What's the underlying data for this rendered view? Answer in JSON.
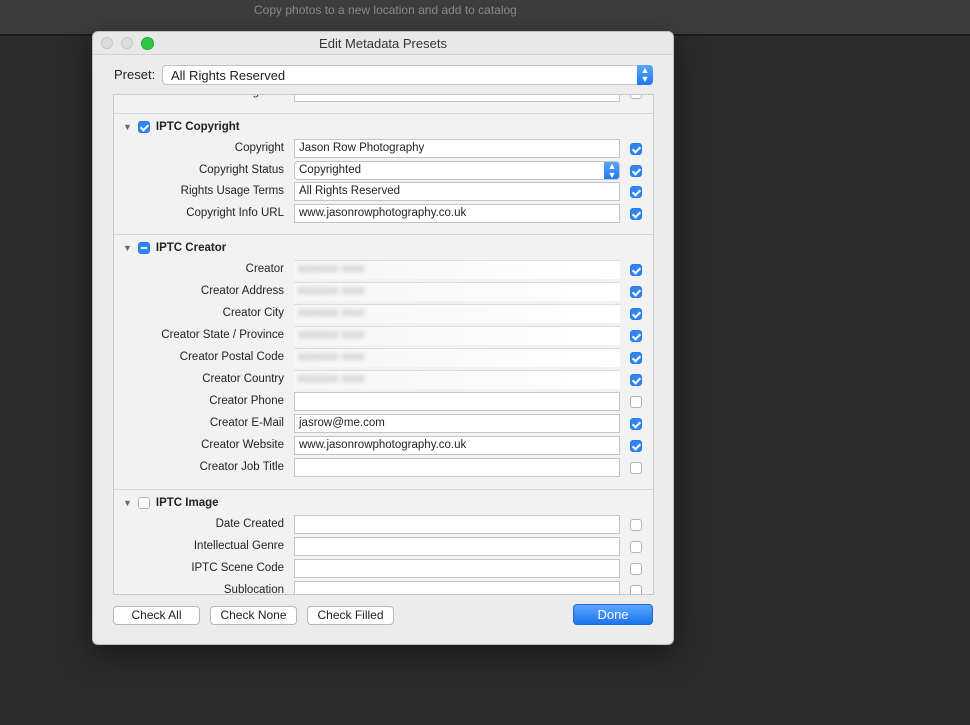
{
  "background_app": {
    "subtitle": "Copy photos to a new location and add to catalog"
  },
  "dialog": {
    "title": "Edit Metadata Presets",
    "preset_label": "Preset:",
    "preset_value": "All Rights Reserved",
    "partial_row": {
      "label": "Other Categories",
      "value": "",
      "checked": false
    },
    "sections": [
      {
        "title": "IPTC Copyright",
        "state": "checked",
        "fields": [
          {
            "label": "Copyright",
            "value": "Jason Row Photography",
            "checked": true,
            "type": "text"
          },
          {
            "label": "Copyright Status",
            "value": "Copyrighted",
            "checked": true,
            "type": "select"
          },
          {
            "label": "Rights Usage Terms",
            "value": "All Rights Reserved",
            "checked": true,
            "type": "text"
          },
          {
            "label": "Copyright Info URL",
            "value": "www.jasonrowphotography.co.uk",
            "checked": true,
            "type": "text"
          }
        ]
      },
      {
        "title": "IPTC Creator",
        "state": "mixed",
        "fields": [
          {
            "label": "Creator",
            "value": "[blurred]",
            "checked": true,
            "type": "blurred"
          },
          {
            "label": "Creator Address",
            "value": "[blurred]",
            "checked": true,
            "type": "blurred"
          },
          {
            "label": "Creator City",
            "value": "[blurred]",
            "checked": true,
            "type": "blurred"
          },
          {
            "label": "Creator State / Province",
            "value": "[blurred]",
            "checked": true,
            "type": "blurred"
          },
          {
            "label": "Creator Postal Code",
            "value": "[blurred]",
            "checked": true,
            "type": "blurred"
          },
          {
            "label": "Creator Country",
            "value": "[blurred]",
            "checked": true,
            "type": "blurred"
          },
          {
            "label": "Creator Phone",
            "value": "",
            "checked": false,
            "type": "text"
          },
          {
            "label": "Creator E-Mail",
            "value": "jasrow@me.com",
            "checked": true,
            "type": "text"
          },
          {
            "label": "Creator Website",
            "value": "www.jasonrowphotography.co.uk",
            "checked": true,
            "type": "text"
          },
          {
            "label": "Creator Job Title",
            "value": "",
            "checked": false,
            "type": "text"
          }
        ]
      },
      {
        "title": "IPTC Image",
        "state": "unchecked",
        "fields": [
          {
            "label": "Date Created",
            "value": "",
            "checked": false,
            "type": "text"
          },
          {
            "label": "Intellectual Genre",
            "value": "",
            "checked": false,
            "type": "text"
          },
          {
            "label": "IPTC Scene Code",
            "value": "",
            "checked": false,
            "type": "text"
          },
          {
            "label": "Sublocation",
            "value": "",
            "checked": false,
            "type": "text"
          }
        ]
      }
    ],
    "buttons": {
      "check_all": "Check All",
      "check_none": "Check None",
      "check_filled": "Check Filled",
      "done": "Done"
    },
    "colors": {
      "accent": "#2f86f5"
    }
  }
}
